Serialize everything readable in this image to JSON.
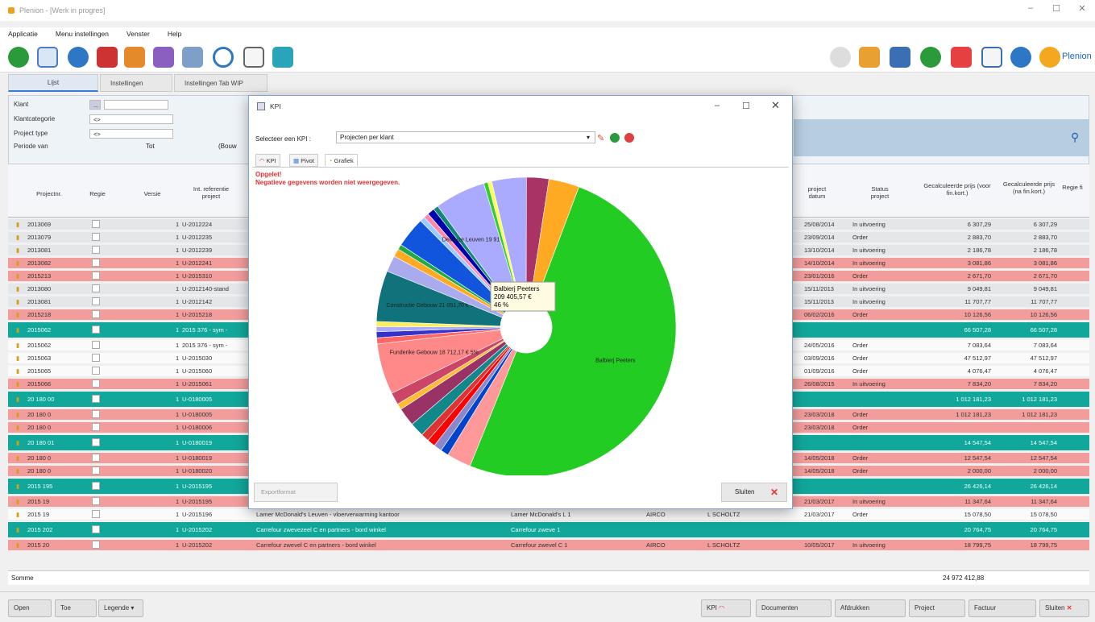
{
  "app": {
    "title": "Plenion - [Werk in progres]"
  },
  "menu": [
    "Applicatie",
    "Menu instellingen",
    "Venster",
    "Help"
  ],
  "brand": "Plenion",
  "tabs": [
    {
      "label": "Lijst"
    },
    {
      "label": "Instellingen"
    },
    {
      "label": "Instellingen Tab WIP"
    }
  ],
  "filters": [
    {
      "label": "Klant",
      "value": "..."
    },
    {
      "label": "Klantcategorie",
      "value": "<>"
    },
    {
      "label": "Project type",
      "value": "<>"
    },
    {
      "label": "Periode van",
      "value": "Tot"
    }
  ],
  "periode_extra": "(Bouw",
  "grid_headers": {
    "projectnr": "Projectnr.",
    "regie": "Regie",
    "versie": "Versie",
    "intref": "Int. referentie project",
    "datum": "project datum",
    "status": "Status project",
    "calc_voor": "Gecalculeerde prijs (voor fin.kort.)",
    "calc_na": "Gecalculeerde prijs (na fin.kort.)",
    "regie_fi": "Regie fi"
  },
  "rows": [
    {
      "kind": "grey",
      "nr": "2013069",
      "v": "1",
      "ref": "U-2012224",
      "datum": "25/08/2014",
      "status": "In uitvoering",
      "c1": "6 307,29",
      "c2": "6 307,29"
    },
    {
      "kind": "grey",
      "nr": "2013079",
      "v": "1",
      "ref": "U-2012235",
      "datum": "23/09/2014",
      "status": "Order",
      "c1": "2 883,70",
      "c2": "2 883,70"
    },
    {
      "kind": "grey",
      "nr": "2013081",
      "v": "1",
      "ref": "U-2012239",
      "datum": "13/10/2014",
      "status": "In uitvoering",
      "c1": "2 186,78",
      "c2": "2 186,78"
    },
    {
      "kind": "pink",
      "nr": "2013082",
      "v": "1",
      "ref": "U-2012241",
      "datum": "14/10/2014",
      "status": "In uitvoering",
      "c1": "3 081,86",
      "c2": "3 081,86"
    },
    {
      "kind": "pink",
      "nr": "2015213",
      "v": "1",
      "ref": "U-2015310",
      "datum": "23/01/2016",
      "status": "Order",
      "c1": "2 671,70",
      "c2": "2 671,70"
    },
    {
      "kind": "grey",
      "nr": "2013080",
      "v": "1",
      "ref": "U-2012140-stand",
      "datum": "15/11/2013",
      "status": "In uitvoering",
      "c1": "9 049,81",
      "c2": "9 049,81"
    },
    {
      "kind": "grey",
      "nr": "2013081",
      "v": "1",
      "ref": "U-2012142",
      "datum": "15/11/2013",
      "status": "In uitvoering",
      "c1": "11 707,77",
      "c2": "11 707,77"
    },
    {
      "kind": "pink",
      "nr": "2015218",
      "v": "1",
      "ref": "U-2015218",
      "datum": "06/02/2016",
      "status": "Order",
      "c1": "10 126,56",
      "c2": "10 126,56"
    },
    {
      "kind": "group",
      "nr": "2015062",
      "v": "1",
      "ref": "2015 376 - sym -",
      "datum": "",
      "status": "",
      "c1": "66 507,28",
      "c2": "66 507,28"
    },
    {
      "kind": "white",
      "nr": "2015062",
      "v": "1",
      "ref": "2015 376 - sym -",
      "datum": "24/05/2016",
      "status": "Order",
      "c1": "7 083,64",
      "c2": "7 083,64"
    },
    {
      "kind": "white",
      "nr": "2015063",
      "v": "1",
      "ref": "U-2015030",
      "datum": "03/09/2016",
      "status": "Order",
      "c1": "47 512,97",
      "c2": "47 512,97"
    },
    {
      "kind": "white",
      "nr": "2015065",
      "v": "1",
      "ref": "U-2015060",
      "datum": "01/09/2016",
      "status": "Order",
      "c1": "4 076,47",
      "c2": "4 076,47"
    },
    {
      "kind": "pink",
      "nr": "2015066",
      "v": "1",
      "ref": "U-2015061",
      "datum": "26/08/2015",
      "status": "In uitvoering",
      "c1": "7 834,20",
      "c2": "7 834,20"
    },
    {
      "kind": "group",
      "nr": "20 180 00",
      "v": "1",
      "ref": "U-0180005",
      "datum": "",
      "status": "",
      "c1": "1 012 181,23",
      "c2": "1 012 181,23"
    },
    {
      "kind": "pink",
      "nr": "20 180 0",
      "v": "1",
      "ref": "U-0180005",
      "datum": "23/03/2018",
      "status": "Order",
      "c1": "1 012 181,23",
      "c2": "1 012 181,23"
    },
    {
      "kind": "pink",
      "nr": "20 180 0",
      "v": "1",
      "ref": "U-0180006",
      "datum": "23/03/2018",
      "status": "Order",
      "c1": "",
      "c2": ""
    },
    {
      "kind": "group",
      "nr": "20 180 01",
      "v": "1",
      "ref": "U-0180019",
      "datum": "",
      "status": "",
      "c1": "14 547,54",
      "c2": "14 547,54"
    },
    {
      "kind": "pink",
      "nr": "20 180 0",
      "v": "1",
      "ref": "U-0180019",
      "datum": "14/05/2018",
      "status": "Order",
      "c1": "12 547,54",
      "c2": "12 547,54"
    },
    {
      "kind": "pink",
      "nr": "20 180 0",
      "v": "1",
      "ref": "U-0180020",
      "datum": "14/05/2018",
      "status": "Order",
      "c1": "2 000,00",
      "c2": "2 000,00"
    },
    {
      "kind": "group",
      "nr": "2015 195",
      "v": "1",
      "ref": "U-2015195",
      "datum": "",
      "status": "",
      "c1": "26 426,14",
      "c2": "26 426,14"
    },
    {
      "kind": "pink",
      "nr": "2015 19",
      "v": "1",
      "ref": "U-2015195",
      "datum": "21/03/2017",
      "status": "In uitvoering",
      "c1": "11 347,64",
      "c2": "11 347,64"
    },
    {
      "kind": "white",
      "nr": "2015 19",
      "v": "1",
      "ref": "U-2015196",
      "desc": "Lamer McDonald's Leuven - vloerverwarming kantoor",
      "klant": "Lamer McDonald's L 1",
      "cat": "AIRCO",
      "user": "L SCHOLTZ",
      "datum": "21/03/2017",
      "status": "Order",
      "c1": "15 078,50",
      "c2": "15 078,50"
    },
    {
      "kind": "group",
      "nr": "2015 202",
      "v": "1",
      "ref": "U-2015202",
      "desc": "Carrefour zwevezeel C en partners - bord winkel",
      "klant": "Carrefour zweve 1",
      "datum": "",
      "status": "",
      "c1": "20 764,75",
      "c2": "20 764,75"
    },
    {
      "kind": "pink",
      "nr": "2015 20",
      "v": "1",
      "ref": "U-2015202",
      "desc": "Carrefour zwevel C en partners - bord winkel",
      "klant": "Carrefour zwevel C 1",
      "cat": "AIRCO",
      "user": "L SCHOLTZ",
      "datum": "10/05/2017",
      "status": "In uitvoering",
      "c1": "18 799,75",
      "c2": "18 799,75"
    }
  ],
  "somme": {
    "label": "Somme",
    "value": "24 972 412,88"
  },
  "bottom_left": [
    {
      "label": "Open"
    },
    {
      "label": "Toe"
    },
    {
      "label": "Legende"
    }
  ],
  "bottom_right": [
    {
      "label": "KPI"
    },
    {
      "label": "Documenten"
    },
    {
      "label": "Afdrukken"
    },
    {
      "label": "Project"
    },
    {
      "label": "Factuur"
    },
    {
      "label": "Sluiten"
    }
  ],
  "modal": {
    "title": "KPI",
    "select_label": "Selecteer een KPI :",
    "select_value": "Projecten per klant",
    "tabs": [
      {
        "label": "KPI"
      },
      {
        "label": "Pivot"
      },
      {
        "label": "Grafiek"
      }
    ],
    "warning1": "Opgelet!",
    "warning2": "Negatieve gegevens worden niet weergegeven.",
    "tooltip": {
      "line1": "Balbierj Peeters",
      "line2": "209 405,57 €",
      "line3": "46 %"
    },
    "export_label": "Exportformat",
    "close_label": "Sluiten"
  },
  "chart_data": {
    "type": "pie",
    "donut": true,
    "slices": [
      {
        "label": "Balbierj Peeters",
        "value": 46,
        "color": "#22cc22"
      },
      {
        "label": "",
        "value": 2.4,
        "color": "#ff9999"
      },
      {
        "label": "",
        "value": 0.8,
        "color": "#0044cc"
      },
      {
        "label": "",
        "value": 0.8,
        "color": "#8888cc"
      },
      {
        "label": "",
        "value": 0.8,
        "color": "#ff0000"
      },
      {
        "label": "",
        "value": 0.8,
        "color": "#dd3333"
      },
      {
        "label": "",
        "value": 1.4,
        "color": "#11888a"
      },
      {
        "label": "",
        "value": 1.8,
        "color": "#993366"
      },
      {
        "label": "",
        "value": 0.6,
        "color": "#ffbb33"
      },
      {
        "label": "",
        "value": 1.2,
        "color": "#cc4466"
      },
      {
        "label": "Funderike Gebouw 18 712,17 € 5%",
        "value": 5,
        "color": "#ff8888"
      },
      {
        "label": "",
        "value": 0.6,
        "color": "#ff6666"
      },
      {
        "label": "",
        "value": 0.6,
        "color": "#3333cc"
      },
      {
        "label": "",
        "value": 0.5,
        "color": "#aaaaff"
      },
      {
        "label": "",
        "value": 0.5,
        "color": "#ffee55"
      },
      {
        "label": "Constructie Gebouw 21 051,70 € 5%",
        "value": 5,
        "color": "#10727a"
      },
      {
        "label": "",
        "value": 1.6,
        "color": "#aaaaee"
      },
      {
        "label": "",
        "value": 0.8,
        "color": "#ffaa22"
      },
      {
        "label": "",
        "value": 0.5,
        "color": "#22aa44"
      },
      {
        "label": "",
        "value": 3,
        "color": "#1155dd"
      },
      {
        "label": "",
        "value": 0.5,
        "color": "#99ccff"
      },
      {
        "label": "",
        "value": 0.5,
        "color": "#ff88aa"
      },
      {
        "label": "",
        "value": 0.7,
        "color": "#0000aa"
      },
      {
        "label": "",
        "value": 0.5,
        "color": "#118877"
      },
      {
        "label": "Delhaize Leuven 19 917,73 € 5%",
        "value": 5,
        "color": "#aaaaff"
      },
      {
        "label": "",
        "value": 0.4,
        "color": "#33cc33"
      },
      {
        "label": "",
        "value": 0.4,
        "color": "#ffff55"
      },
      {
        "label": "",
        "value": 3.4,
        "color": "#aaaaff"
      },
      {
        "label": "",
        "value": 2.2,
        "color": "#aa3366"
      },
      {
        "label": "",
        "value": 3,
        "color": "#ffaa22"
      }
    ]
  }
}
